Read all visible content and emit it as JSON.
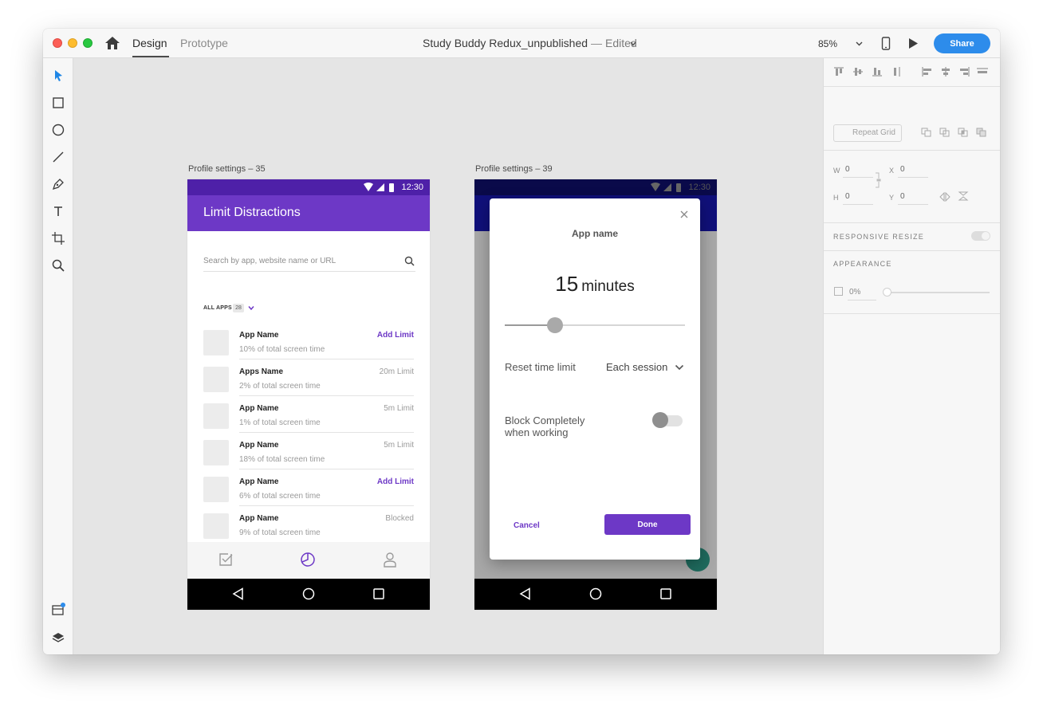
{
  "app": {
    "tabs": {
      "design": "Design",
      "prototype": "Prototype"
    },
    "doc_title": "Study Buddy Redux_unpublished",
    "doc_sep": "—",
    "doc_status": "Edited",
    "zoom": "85%",
    "share_label": "Share"
  },
  "artboards": {
    "left_label": "Profile settings – 35",
    "right_label": "Profile settings – 39"
  },
  "phone1": {
    "status_time": "12:30",
    "title": "Limit Distractions",
    "search_placeholder": "Search by app, website name or URL",
    "filter_label": "ALL APPS",
    "filter_count": "28",
    "apps": [
      {
        "name": "App Name",
        "sub": "10% of total screen time",
        "limit": "Add Limit"
      },
      {
        "name": "Apps Name",
        "sub": "2% of total screen time",
        "limit": "20m Limit"
      },
      {
        "name": "App Name",
        "sub": "1% of total screen time",
        "limit": "5m Limit"
      },
      {
        "name": "App Name",
        "sub": "18% of total screen time",
        "limit": "5m Limit"
      },
      {
        "name": "App Name",
        "sub": "6% of total screen time",
        "limit": "Add Limit"
      },
      {
        "name": "App Name",
        "sub": "9% of total screen time",
        "limit": "Blocked"
      }
    ]
  },
  "phone2": {
    "status_time": "12:30",
    "dialog": {
      "title": "App name",
      "minutes_value": "15",
      "minutes_unit": "minutes",
      "slider_fraction": 0.28,
      "reset_label": "Reset time limit",
      "reset_value": "Each session",
      "block_label": "Block Completely when working",
      "block_enabled": false,
      "cancel_label": "Cancel",
      "done_label": "Done"
    }
  },
  "panel": {
    "repeat_grid_label": "Repeat Grid",
    "w_label": "W",
    "w_value": "0",
    "h_label": "H",
    "h_value": "0",
    "x_label": "X",
    "x_value": "0",
    "y_label": "Y",
    "y_value": "0",
    "responsive_resize": "RESPONSIVE RESIZE",
    "appearance": "APPEARANCE",
    "opacity_value": "0%"
  },
  "colors": {
    "accent_purple": "#6d38c6",
    "share_blue": "#2d8ceb",
    "status_purple": "#4e20a8"
  }
}
